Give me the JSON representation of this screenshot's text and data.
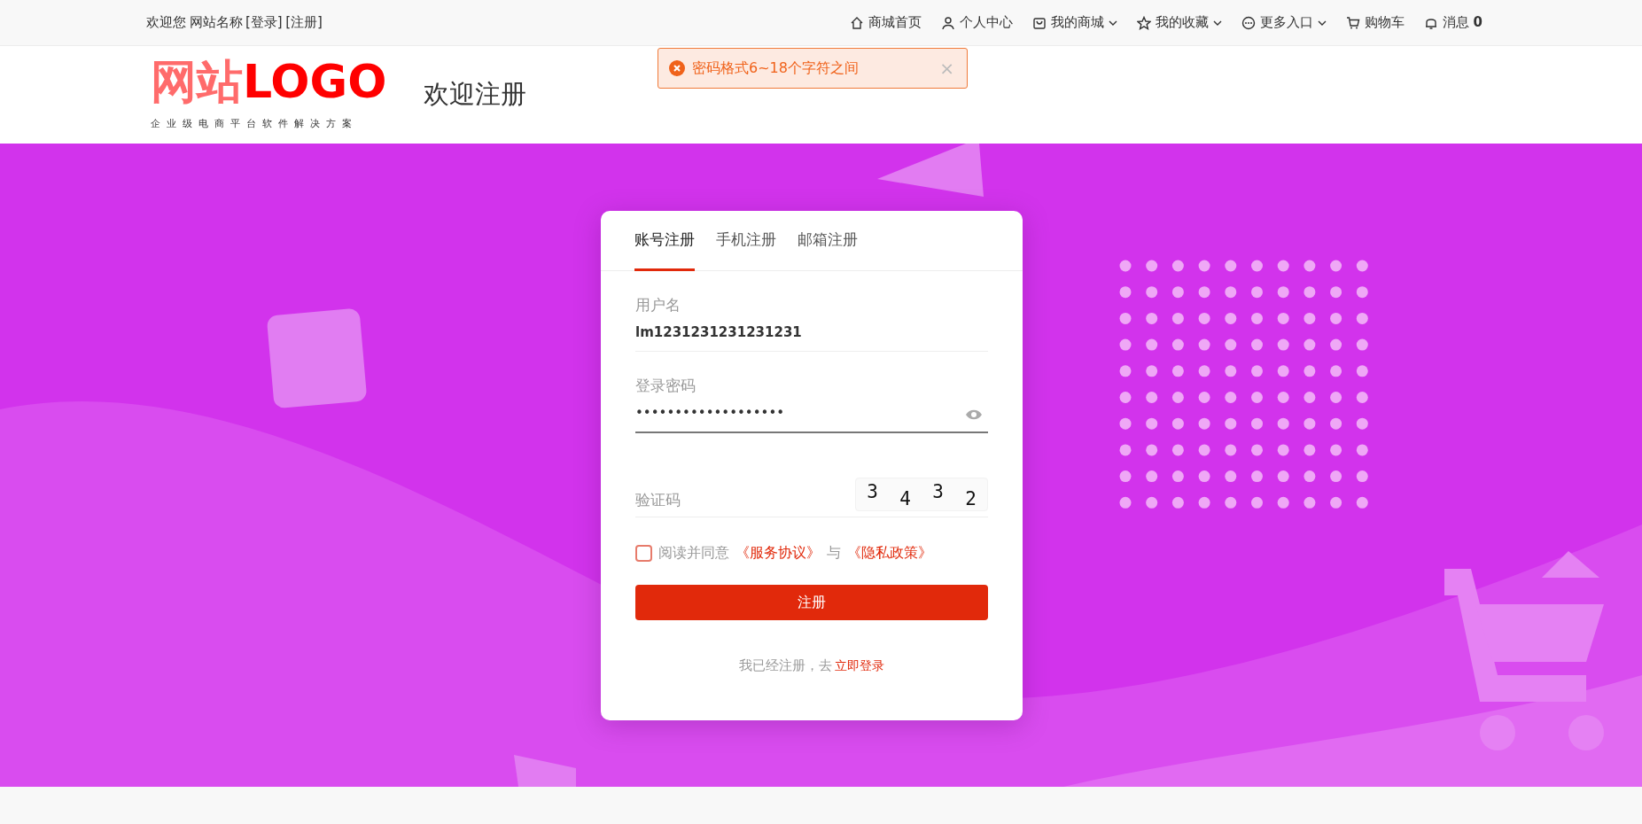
{
  "top_bar": {
    "welcome": "欢迎您",
    "site_name": "网站名称",
    "login": "[登录]",
    "register": "[注册]",
    "nav": [
      {
        "kind": "home",
        "label": "商城首页",
        "dropdown": false
      },
      {
        "kind": "user",
        "label": "个人中心",
        "dropdown": false
      },
      {
        "kind": "shop",
        "label": "我的商城",
        "dropdown": true
      },
      {
        "kind": "star",
        "label": "我的收藏",
        "dropdown": true
      },
      {
        "kind": "more",
        "label": "更多入口",
        "dropdown": true
      },
      {
        "kind": "cart",
        "label": "购物车",
        "dropdown": false
      },
      {
        "kind": "bell",
        "label": "消息",
        "dropdown": false,
        "count": "0"
      }
    ]
  },
  "toast": {
    "kind": "error",
    "message": "密码格式6~18个字符之间",
    "close": "×"
  },
  "header": {
    "logo_cn": "网站",
    "logo_en": "LOGO",
    "tagline": "企业级电商平台软件解决方案",
    "page_title": "欢迎注册"
  },
  "tabs": [
    {
      "label": "账号注册",
      "selected": true
    },
    {
      "label": "手机注册",
      "selected": false
    },
    {
      "label": "邮箱注册",
      "selected": false
    }
  ],
  "form": {
    "username": {
      "label": "用户名",
      "value": "lm1231231231231231"
    },
    "password": {
      "label": "登录密码",
      "value": "•••••••••••••••••••",
      "focused": true
    },
    "captcha": {
      "label": "验证码",
      "digits": [
        "3",
        "4",
        "3",
        "2"
      ]
    },
    "agreement": {
      "checked": false,
      "prefix": "阅读并同意",
      "terms": "《服务协议》",
      "joiner": "与",
      "privacy": "《隐私政策》"
    },
    "submit": "注册",
    "login_prompt": "我已经注册，去",
    "login_link": "立即登录"
  }
}
